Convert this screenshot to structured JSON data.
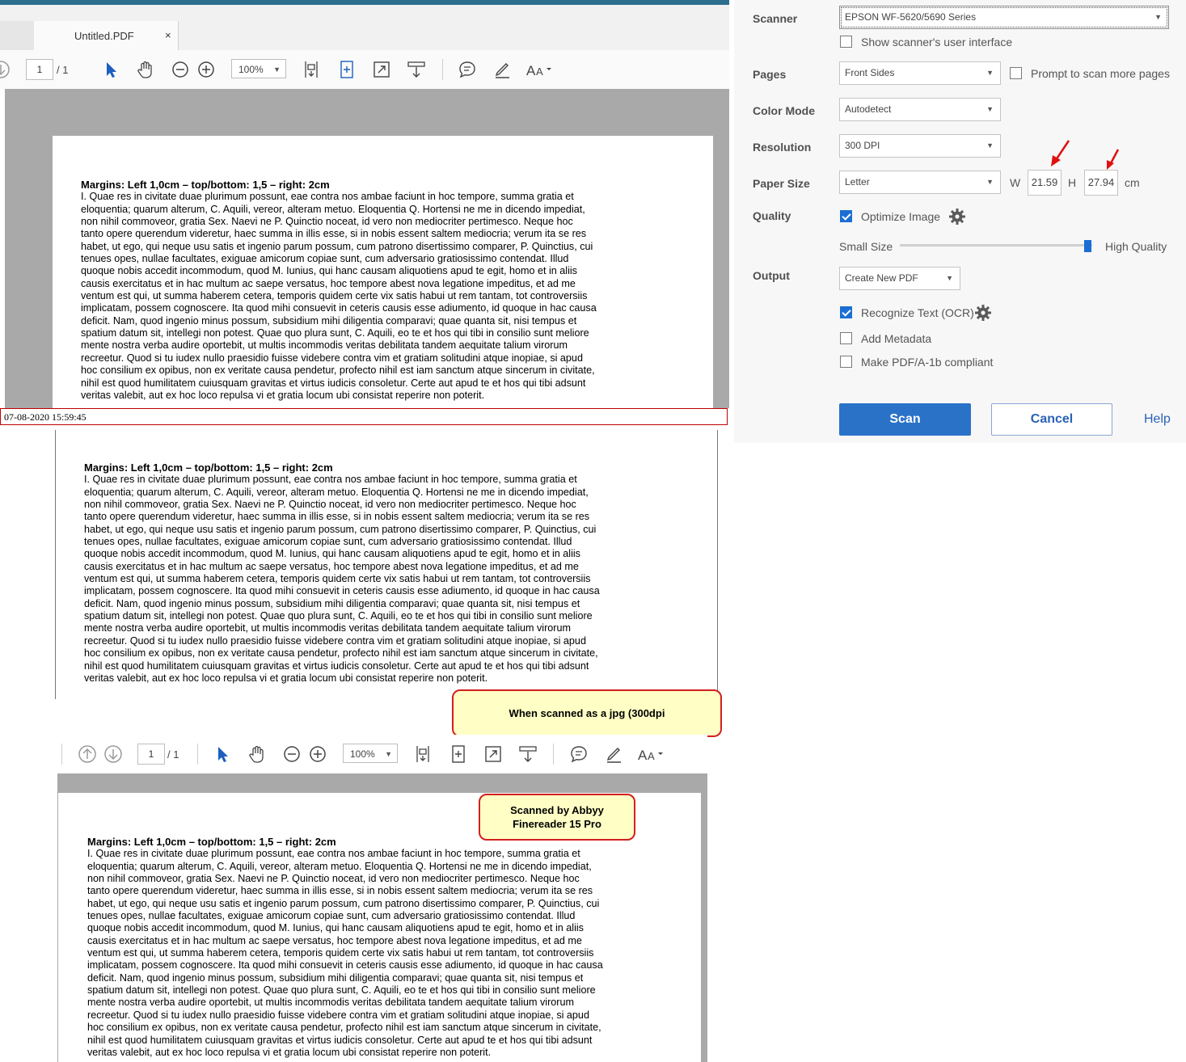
{
  "reader_top": {
    "tab_title": "Untitled.PDF",
    "tab_close": "×",
    "page_current": "1",
    "page_total": "/ 1",
    "zoom": "100%"
  },
  "reader_bottom": {
    "page_current": "1",
    "page_total": "/ 1",
    "zoom": "100%"
  },
  "document": {
    "heading": "Margins: Left 1,0cm – top/bottom: 1,5 – right: 2cm",
    "lines": [
      "I. Quae res in civitate duae plurimum possunt, eae contra nos ambae faciunt in hoc tempore, summa gratia et",
      "eloquentia; quarum alterum, C. Aquili, vereor, alteram metuo. Eloquentia Q. Hortensi ne me in dicendo impediat,",
      "non nihil commoveor, gratia Sex. Naevi ne P. Quinctio noceat, id vero non mediocriter pertimesco. Neque hoc",
      "tanto opere querendum videretur, haec summa in illis esse, si in nobis essent saltem mediocria; verum ita se res",
      "habet, ut ego, qui neque usu satis et ingenio parum possum, cum patrono disertissimo comparer, P. Quinctius, cui",
      "tenues opes, nullae facultates, exiguae amicorum copiae sunt, cum adversario gratiosissimo contendat. Illud",
      "quoque nobis accedit incommodum, quod M. Iunius, qui hanc causam aliquotiens apud te egit, homo et in aliis",
      "causis exercitatus et in hac multum ac saepe versatus, hoc tempore abest nova legatione impeditus, et ad me",
      "ventum est qui, ut summa haberem cetera, temporis quidem certe vix satis habui ut rem tantam, tot controversiis",
      "implicatam, possem cognoscere. Ita quod mihi consuevit in ceteris causis esse adiumento, id quoque in hac causa",
      "deficit. Nam, quod ingenio minus possum, subsidium mihi diligentia comparavi; quae quanta sit, nisi tempus et",
      "spatium datum sit, intellegi non potest. Quae quo plura sunt, C. Aquili, eo te et hos qui tibi in consilio sunt meliore",
      "mente nostra verba audire oportebit, ut multis incommodis veritas debilitata tandem aequitate talium virorum",
      "recreetur. Quod si tu iudex nullo praesidio fuisse videbere contra vim et gratiam solitudini atque inopiae, si apud",
      "hoc consilium ex opibus, non ex veritate causa pendetur, profecto nihil est iam sanctum atque sincerum in civitate,",
      "nihil est quod humilitatem cuiusquam gravitas et virtus iudicis consoletur. Certe aut apud te et hos qui tibi adsunt",
      "veritas valebit, aut ex hoc loco repulsa vi et gratia locum ubi consistat reperire non poterit."
    ]
  },
  "timestamp": "07-08-2020 15:59:45",
  "callouts": {
    "jpg": "When scanned as a jpg (300dpi",
    "abbyy": "Scanned by Abbyy Finereader 15 Pro"
  },
  "dialog": {
    "scanner_label": "Scanner",
    "scanner_value": "EPSON WF-5620/5690 Series",
    "show_ui_label": "Show scanner's user interface",
    "show_ui_checked": false,
    "pages_label": "Pages",
    "pages_value": "Front Sides",
    "prompt_label": "Prompt to scan more pages",
    "prompt_checked": false,
    "color_mode_label": "Color Mode",
    "color_mode_value": "Autodetect",
    "resolution_label": "Resolution",
    "resolution_value": "300 DPI",
    "paper_size_label": "Paper Size",
    "paper_size_value": "Letter",
    "w_label": "W",
    "w_value": "21.59",
    "h_label": "H",
    "h_value": "27.94",
    "unit": "cm",
    "quality_label": "Quality",
    "optimize_label": "Optimize Image",
    "optimize_checked": true,
    "small_size": "Small Size",
    "high_quality": "High Quality",
    "quality_level": 1.0,
    "output_label": "Output",
    "output_value": "Create New PDF",
    "ocr_label": "Recognize Text (OCR)",
    "ocr_checked": true,
    "metadata_label": "Add Metadata",
    "metadata_checked": false,
    "pdfa_label": "Make PDF/A-1b compliant",
    "pdfa_checked": false,
    "scan_button": "Scan",
    "cancel_button": "Cancel",
    "help_link": "Help"
  },
  "colors": {
    "accent_bar": "#2c6e8e",
    "primary_button": "#2a72c8",
    "callout_border": "#d21f1f",
    "callout_fill": "#ffffc5",
    "arrow": "#e01010"
  }
}
